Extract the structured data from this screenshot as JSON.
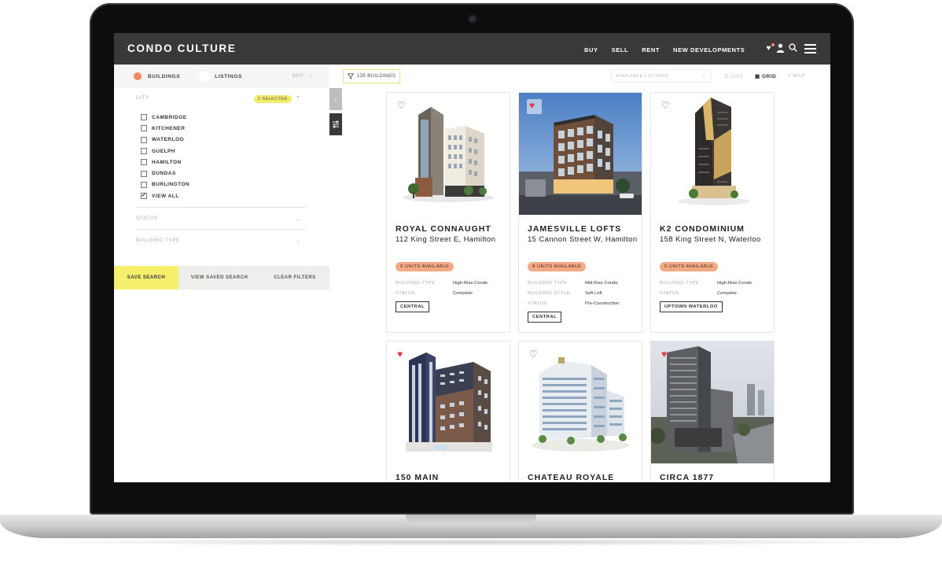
{
  "header": {
    "brand": "CONDO CULTURE",
    "nav": [
      "BUY",
      "SELL",
      "RENT",
      "NEW DEVELOPMENTS"
    ],
    "icons": [
      "heart-icon",
      "user-icon",
      "search-icon",
      "menu-icon"
    ]
  },
  "filters": {
    "mode_buildings": "BUILDINGS",
    "mode_listings": "LISTINGS",
    "mode_select": "BUY",
    "city_label": "CITY",
    "city_selected": "1 SELECTED",
    "cities": [
      {
        "label": "CAMBRIDGE",
        "checked": false
      },
      {
        "label": "KITCHENER",
        "checked": false
      },
      {
        "label": "WATERLOO",
        "checked": false
      },
      {
        "label": "GUELPH",
        "checked": false
      },
      {
        "label": "HAMILTON",
        "checked": false
      },
      {
        "label": "DUNDAS",
        "checked": false
      },
      {
        "label": "BURLINGTON",
        "checked": false
      },
      {
        "label": "VIEW ALL",
        "checked": true
      }
    ],
    "status_label": "STATUS",
    "building_type_label": "BUILDING TYPE",
    "save_search": "SAVE SEARCH",
    "view_saved": "VIEW SAVED SEARCH",
    "clear_filters": "CLEAR FILTERS"
  },
  "toolbar": {
    "buildings_count": "135 BUILDINGS",
    "listing_select": "AVAILABLE LISTINGS",
    "view_list": "LIST",
    "view_grid": "GRID",
    "view_map": "MAP"
  },
  "cards": [
    {
      "title": "ROYAL CONNAUGHT",
      "address": "112 King Street E, Hamilton",
      "units": "9 UNITS AVAILABLE",
      "favorited": false,
      "meta": [
        {
          "key": "BUILDING TYPE",
          "value": "High-Rise Condo"
        },
        {
          "key": "STATUS",
          "value": "Complete"
        }
      ],
      "tag": "CENTRAL"
    },
    {
      "title": "JAMESVILLE LOFTS",
      "address": "15 Cannon Street W, Hamilton",
      "units": "8 UNITS AVAILABLE",
      "favorited": true,
      "meta": [
        {
          "key": "BUILDING TYPE",
          "value": "Mid-Rise Condo"
        },
        {
          "key": "BUILDING STYLE",
          "value": "Soft Loft"
        },
        {
          "key": "STATUS",
          "value": "Pre-Construction"
        }
      ],
      "tag": "CENTRAL"
    },
    {
      "title": "K2 CONDOMINIUM",
      "address": "158 King Street N, Waterloo",
      "units": "5 UNITS AVAILABLE",
      "favorited": false,
      "meta": [
        {
          "key": "BUILDING TYPE",
          "value": "High-Rise Condo"
        },
        {
          "key": "STATUS",
          "value": "Complete"
        }
      ],
      "tag": "UPTOWN WATERLOO"
    },
    {
      "title": "150 MAIN",
      "favorited": true
    },
    {
      "title": "CHATEAU ROYALE",
      "favorited": false
    },
    {
      "title": "CIRCA 1877",
      "favorited": true
    }
  ],
  "colors": {
    "accent_orange": "#f08b5e",
    "accent_yellow": "#f6ef6c",
    "nav_bg": "#3b3838",
    "heart_red": "#e8344a"
  }
}
